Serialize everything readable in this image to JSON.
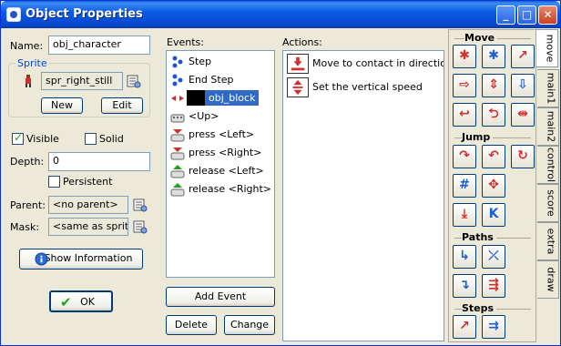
{
  "window": {
    "title": "Object Properties"
  },
  "titlebar_buttons": {
    "minimize": "_",
    "maximize": "□",
    "close": "✕"
  },
  "left": {
    "name_label": "Name:",
    "name_value": "obj_character",
    "sprite_group": "Sprite",
    "sprite_value": "spr_right_still",
    "new_button": "New",
    "edit_button": "Edit",
    "visible_label": "Visible",
    "visible_checked": true,
    "solid_label": "Solid",
    "solid_checked": false,
    "depth_label": "Depth:",
    "depth_value": "0",
    "persistent_label": "Persistent",
    "persistent_checked": false,
    "parent_label": "Parent:",
    "parent_value": "<no parent>",
    "mask_label": "Mask:",
    "mask_value": "<same as sprite>",
    "show_info_button": "Show Information",
    "ok_button": "OK"
  },
  "events": {
    "label": "Events:",
    "items": [
      {
        "label": "Step",
        "icon": "step-icon"
      },
      {
        "label": "End Step",
        "icon": "step-icon"
      },
      {
        "label": "obj_block",
        "icon": "collision-icon",
        "selected": true
      },
      {
        "label": "<Up>",
        "icon": "keyboard-icon"
      },
      {
        "label": "press <Left>",
        "icon": "keyboard-press-icon"
      },
      {
        "label": "press <Right>",
        "icon": "keyboard-press-icon"
      },
      {
        "label": "release <Left>",
        "icon": "keyboard-release-icon"
      },
      {
        "label": "release <Right>",
        "icon": "keyboard-release-icon"
      }
    ],
    "add_button": "Add Event",
    "delete_button": "Delete",
    "change_button": "Change"
  },
  "actions": {
    "label": "Actions:",
    "items": [
      {
        "label": "Move to contact in direction di",
        "icon": "move-contact-icon"
      },
      {
        "label": "Set the vertical speed",
        "icon": "vertical-speed-icon"
      }
    ]
  },
  "palette": {
    "sections": {
      "move": "Move",
      "jump": "Jump",
      "paths": "Paths",
      "steps": "Steps"
    }
  },
  "tabs": [
    "move",
    "main1",
    "main2",
    "control",
    "score",
    "extra",
    "draw"
  ],
  "colors": {
    "selection": "#316ac5",
    "title_blue": "#0846cc",
    "accent_red": "#d22f2f"
  }
}
